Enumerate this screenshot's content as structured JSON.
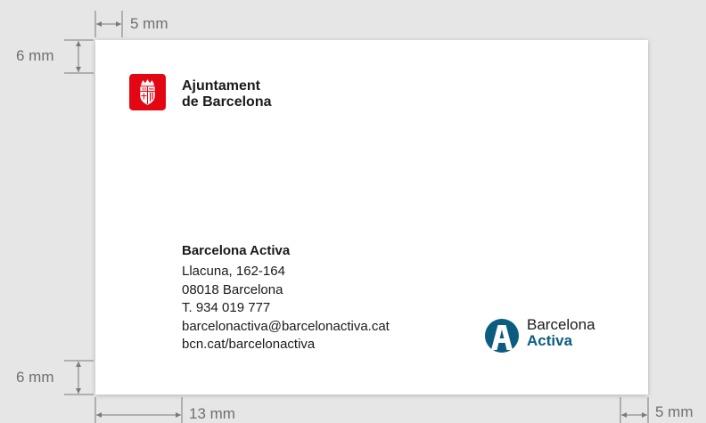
{
  "dimensions": {
    "top_margin_left": "5 mm",
    "left_margin_top": "6 mm",
    "left_margin_bottom": "6 mm",
    "bottom_margin_left": "13 mm",
    "bottom_margin_right": "5 mm"
  },
  "card": {
    "issuer": {
      "line1": "Ajuntament",
      "line2": "de Barcelona",
      "logo_icon": "barcelona-shield-icon",
      "logo_color": "#e30613"
    },
    "contact": {
      "organization": "Barcelona Activa",
      "address_line": "Llacuna, 162-164",
      "postal_city": "08018 Barcelona",
      "phone": "T. 934 019 777",
      "email": "barcelonactiva@barcelonactiva.cat",
      "website": "bcn.cat/barcelonactiva"
    },
    "brand": {
      "word1": "Barcelona",
      "word2": "Activa",
      "logo_icon": "barcelona-activa-a-icon",
      "brand_color": "#0b5d80"
    }
  },
  "colors": {
    "background": "#e6e6e6",
    "card": "#ffffff",
    "guide_lines": "#6f6f6f"
  }
}
